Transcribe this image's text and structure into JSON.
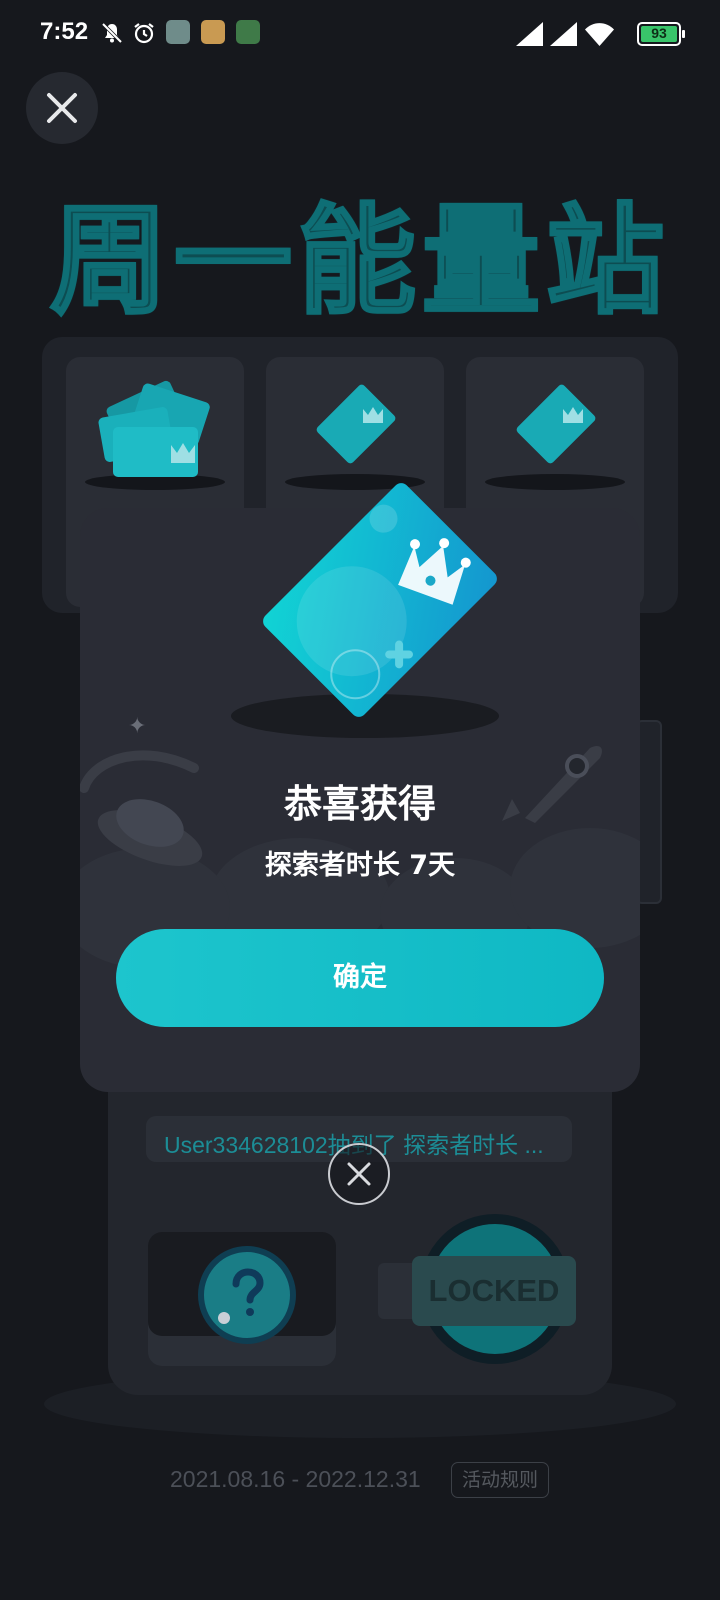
{
  "status_bar": {
    "time": "7:52",
    "battery": "93",
    "icons": [
      "bell-off-icon",
      "alarm-icon",
      "app-icon-gallery",
      "app-icon-camera",
      "app-icon-music",
      "signal-icon",
      "signal-icon-2",
      "wifi-icon",
      "battery-icon"
    ]
  },
  "page": {
    "title": "周一能量站",
    "ticker": "User334628102抽到了 探索者时长 ...",
    "locked_label": "LOCKED",
    "date_range": "2021.08.16 - 2022.12.31",
    "rules_label": "活动规则",
    "accent": "#13c2cc"
  },
  "dialog": {
    "title": "恭喜获得",
    "reward": "探索者时长 7天",
    "confirm_label": "确定"
  }
}
